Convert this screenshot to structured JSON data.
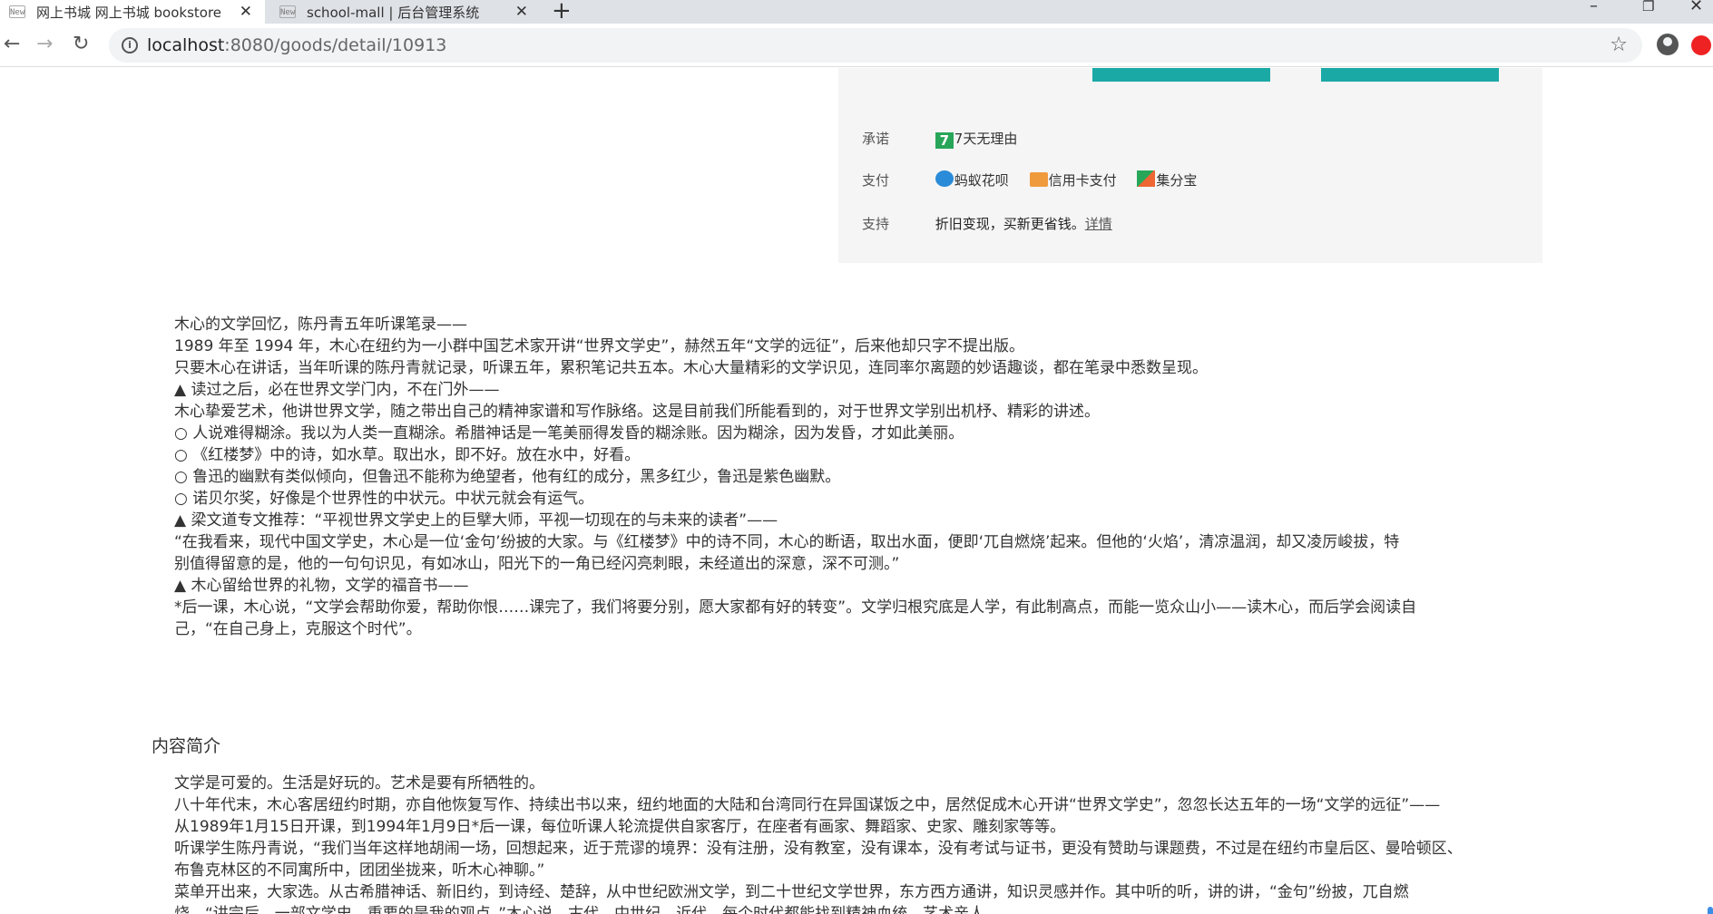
{
  "browser": {
    "tabs": [
      {
        "favicon": "New",
        "title": "网上书城 网上书城 bookstore"
      },
      {
        "favicon": "New",
        "title": "school-mall | 后台管理系统"
      }
    ],
    "url_host": "localhost",
    "url_path": ":8080/goods/detail/10913"
  },
  "info": {
    "promise_label": "承诺",
    "promise_icon": "7",
    "promise_text": "7天无理由",
    "pay_label": "支付",
    "pay_items": [
      "蚂蚁花呗",
      "信用卡支付",
      "集分宝"
    ],
    "support_label": "支持",
    "support_text": "折旧变现，买新更省钱。",
    "support_link": "详情"
  },
  "review": [
    "木心的文学回忆，陈丹青五年听课笔录——",
    "1989 年至 1994 年，木心在纽约为一小群中国艺术家开讲“世界文学史”，赫然五年“文学的远征”，后来他却只字不提出版。",
    "只要木心在讲话，当年听课的陈丹青就记录，听课五年，累积笔记共五本。木心大量精彩的文学识见，连同率尔离题的妙语趣谈，都在笔录中悉数呈现。",
    "▲ 读过之后，必在世界文学门内，不在门外——",
    "木心挚爱艺术，他讲世界文学，随之带出自己的精神家谱和写作脉络。这是目前我们所能看到的，对于世界文学别出机杼、精彩的讲述。",
    "○ 人说难得糊涂。我以为人类一直糊涂。希腊神话是一笔美丽得发昏的糊涂账。因为糊涂，因为发昏，才如此美丽。",
    "○ 《红楼梦》中的诗，如水草。取出水，即不好。放在水中，好看。",
    "○ 鲁迅的幽默有类似倾向，但鲁迅不能称为绝望者，他有红的成分，黑多红少，鲁迅是紫色幽默。",
    "○ 诺贝尔奖，好像是个世界性的中状元。中状元就会有运气。",
    "▲ 梁文道专文推荐：“平视世界文学史上的巨擘大师，平视一切现在的与未来的读者”——",
    "“在我看来，现代中国文学史，木心是一位‘金句’纷披的大家。与《红楼梦》中的诗不同，木心的断语，取出水面，便即‘兀自燃烧’起来。但他的‘火焰’，清凉温润，却又凌厉峻拔，特",
    "别值得留意的是，他的一句句识见，有如冰山，阳光下的一角已经闪亮刺眼，未经道出的深意，深不可测。”",
    "▲ 木心留给世界的礼物，文学的福音书——",
    "*后一课，木心说，“文学会帮助你爱，帮助你恨……课完了，我们将要分别，愿大家都有好的转变”。文学归根究底是人学，有此制高点，而能一览众山小——读木心，而后学会阅读自",
    "己，“在自己身上，克服这个时代”。"
  ],
  "intro_title": "内容简介",
  "intro": [
    "文学是可爱的。生活是好玩的。艺术是要有所牺牲的。",
    "八十年代末，木心客居纽约时期，亦自他恢复写作、持续出书以来，纽约地面的大陆和台湾同行在异国谋饭之中，居然促成木心开讲“世界文学史”，忽忽长达五年的一场“文学的远征”——",
    "从1989年1月15日开课，到1994年1月9日*后一课，每位听课人轮流提供自家客厅，在座者有画家、舞蹈家、史家、雕刻家等等。",
    "听课学生陈丹青说，“我们当年这样地胡闹一场，回想起来，近于荒谬的境界：没有注册，没有教室，没有课本，没有考试与证书，更没有赞助与课题费，不过是在纽约市皇后区、曼哈顿区、",
    "布鲁克林区的不同寓所中，团团坐拢来，听木心神聊。”",
    "菜单开出来，大家选。从古希腊神话、新旧约，到诗经、楚辞，从中世纪欧洲文学，到二十世纪文学世界，东方西方通讲，知识灵感并作。其中听的听，讲的讲，“金句”纷披，兀自燃",
    "烧，“讲完后，一部文学史，重要的是我的观点。”木心说。古代、中世纪、近代，每个时代都能找到精神血统，艺术亲人"
  ]
}
